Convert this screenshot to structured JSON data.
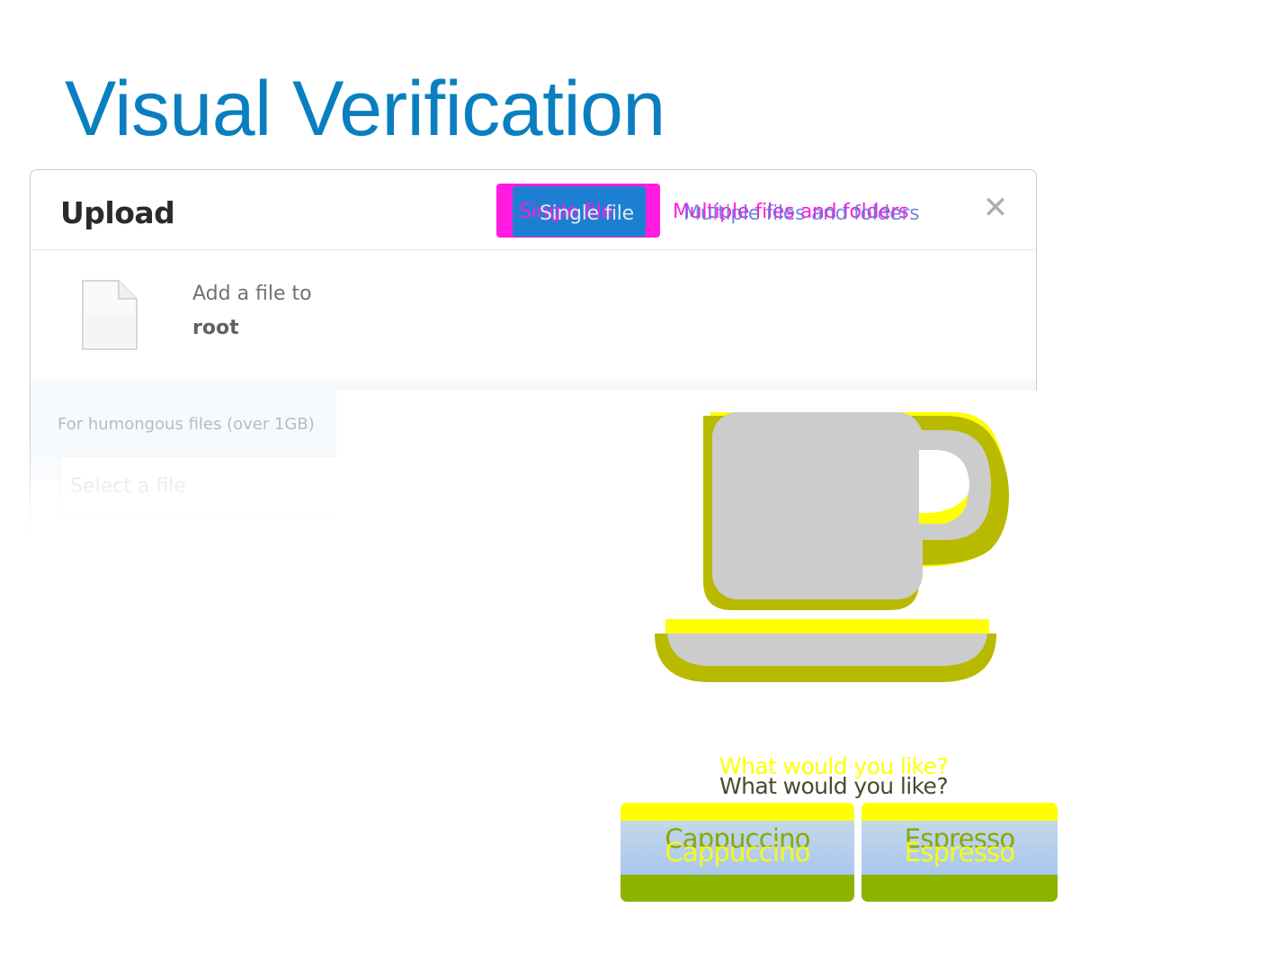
{
  "slide": {
    "title": "Visual Verification"
  },
  "upload_dialog": {
    "title": "Upload",
    "tabs": {
      "single": "Single file",
      "multiple": "Multiple files and folders"
    },
    "close_icon": "close-icon",
    "file_icon": "document-icon",
    "add_file_label": "Add a file to",
    "destination": "root",
    "humongous_note": "For humongous files (over 1GB)",
    "select_placeholder": "Select a file"
  },
  "coffee_app": {
    "icon": "coffee-cup-icon",
    "question": "What would you like?",
    "buttons": {
      "cappuccino": "Cappuccino",
      "espresso": "Espresso"
    }
  },
  "colors": {
    "title_blue": "#0a7fc0",
    "tab_highlight_magenta": "#ff1ce0",
    "tab_active_blue": "#1d7fd1",
    "diff_yellow": "#ffff00",
    "diff_olive": "#b8ba00",
    "cup_gray": "#cccccc",
    "button_green": "#8db300"
  }
}
